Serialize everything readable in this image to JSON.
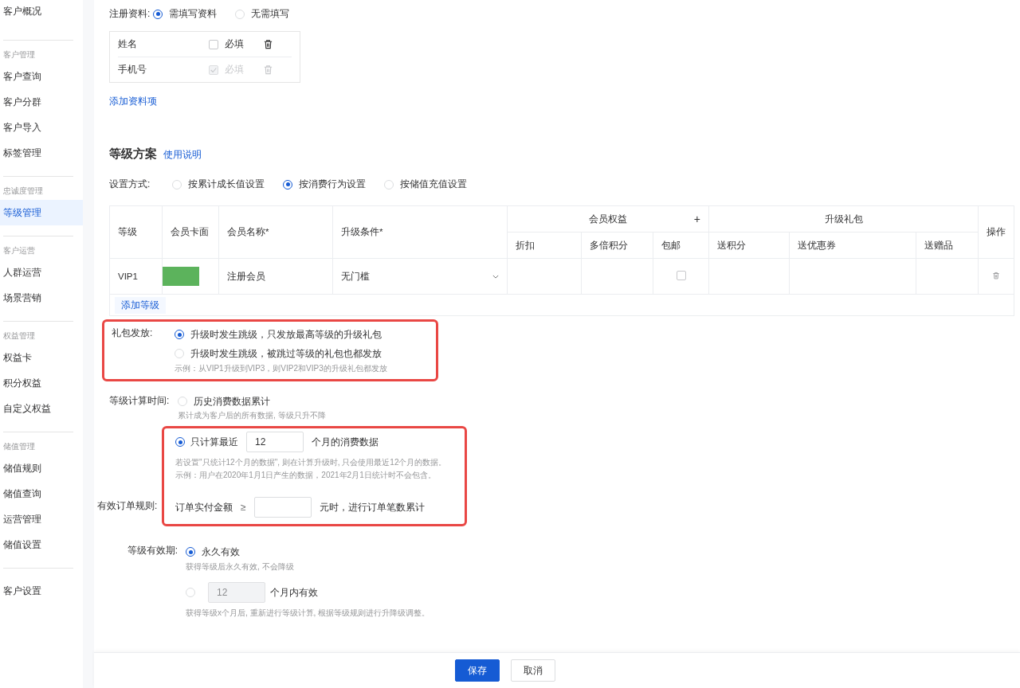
{
  "sidebar": {
    "groups": [
      {
        "items": [
          {
            "label": "客户概况",
            "selected": false
          }
        ]
      },
      {
        "label": "客户管理",
        "items": [
          {
            "label": "客户查询",
            "selected": false
          },
          {
            "label": "客户分群",
            "selected": false
          },
          {
            "label": "客户导入",
            "selected": false
          },
          {
            "label": "标签管理",
            "selected": false
          }
        ]
      },
      {
        "label": "忠诚度管理",
        "items": [
          {
            "label": "等级管理",
            "selected": true
          }
        ]
      },
      {
        "label": "客户运营",
        "items": [
          {
            "label": "人群运营",
            "selected": false
          },
          {
            "label": "场景营销",
            "selected": false
          }
        ]
      },
      {
        "label": "权益管理",
        "items": [
          {
            "label": "权益卡",
            "selected": false
          },
          {
            "label": "积分权益",
            "selected": false
          },
          {
            "label": "自定义权益",
            "selected": false
          }
        ]
      },
      {
        "label": "储值管理",
        "items": [
          {
            "label": "储值规则",
            "selected": false
          },
          {
            "label": "储值查询",
            "selected": false
          },
          {
            "label": "运营管理",
            "selected": false
          },
          {
            "label": "储值设置",
            "selected": false
          }
        ]
      },
      {
        "items": [
          {
            "label": "客户设置",
            "selected": false
          }
        ]
      }
    ]
  },
  "registration": {
    "label": "注册资料:",
    "options": [
      {
        "label": "需填写资料",
        "selected": true
      },
      {
        "label": "无需填写",
        "selected": false
      }
    ],
    "fields": [
      {
        "name": "姓名",
        "required_label": "必填",
        "checked": false,
        "disabled": false
      },
      {
        "name": "手机号",
        "required_label": "必填",
        "checked": true,
        "disabled": true
      }
    ],
    "add_link": "添加资料项"
  },
  "level_plan": {
    "title": "等级方案",
    "help_link": "使用说明",
    "method": {
      "label": "设置方式:",
      "options": [
        {
          "label": "按累计成长值设置",
          "selected": false
        },
        {
          "label": "按消费行为设置",
          "selected": true
        },
        {
          "label": "按储值充值设置",
          "selected": false
        }
      ]
    },
    "table": {
      "head": {
        "level": "等级",
        "card": "会员卡面",
        "name": "会员名称*",
        "condition": "升级条件*",
        "benefits": {
          "label": "会员权益",
          "add": "+",
          "columns": [
            "折扣",
            "多倍积分",
            "包邮"
          ]
        },
        "gifts": {
          "label": "升级礼包",
          "columns": [
            "送积分",
            "送优惠券",
            "送赠品"
          ]
        },
        "actions": "操作"
      },
      "rows": [
        {
          "level": "VIP1",
          "color": "#5cb35c",
          "name": "注册会员",
          "condition": "无门槛",
          "free_shipping": false
        }
      ],
      "add_link": "添加等级"
    }
  },
  "gift_release": {
    "label": "礼包发放:",
    "highlighted": true,
    "options": [
      {
        "label": "升级时发生跳级，只发放最高等级的升级礼包",
        "selected": true
      },
      {
        "label": "升级时发生跳级，被跳过等级的礼包也都发放",
        "selected": false
      }
    ],
    "hint": "示例：从VIP1升级到VIP3，则VIP2和VIP3的升级礼包都发放"
  },
  "calc_time": {
    "label": "等级计算时间:",
    "history": {
      "label": "历史消费数据累计",
      "hint": "累计成为客户后的所有数据, 等级只升不降",
      "selected": false
    },
    "recent": {
      "highlighted": true,
      "selected": true,
      "prefix": "只计算最近",
      "value": "12",
      "suffix": "个月的消费数据",
      "hints": [
        "若设置\"只统计12个月的数据\", 则在计算升级时, 只会使用最近12个月的数据。",
        "示例：用户在2020年1月1日产生的数据，2021年2月1日统计时不会包含。"
      ]
    }
  },
  "order_rule": {
    "label": "有效订单规则:",
    "prefix": "订单实付金额",
    "operator": "≥",
    "suffix": "元时，进行订单笔数累计"
  },
  "validity": {
    "label": "等级有效期:",
    "options": [
      {
        "kind": "plain",
        "label": "永久有效",
        "hint": "获得等级后永久有效, 不会降级",
        "selected": true
      },
      {
        "kind": "months",
        "value": "12",
        "suffix": "个月内有效",
        "hint": "获得等级x个月后, 重新进行等级计算, 根据等级规则进行升降级调整。",
        "selected": false,
        "disabled": true
      }
    ]
  },
  "footer": {
    "buttons": [
      {
        "label": "保存",
        "kind": "primary"
      },
      {
        "label": "取消",
        "kind": "default"
      }
    ]
  }
}
